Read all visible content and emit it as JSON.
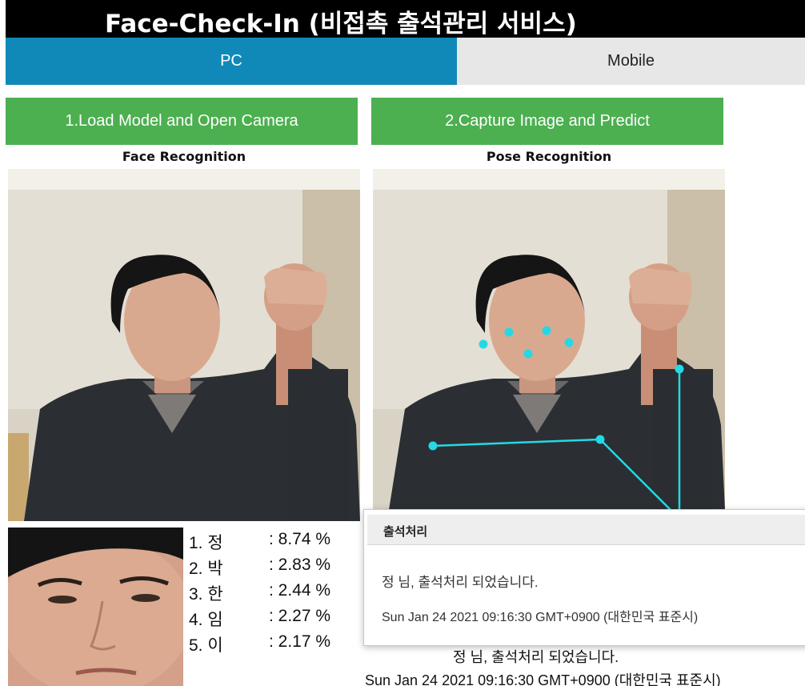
{
  "header": {
    "title": "Face-Check-In (비접촉 출석관리 서비스)"
  },
  "tabs": [
    {
      "label": "PC",
      "active": true
    },
    {
      "label": "Mobile",
      "active": false
    }
  ],
  "buttons": {
    "load_model": "1.Load Model and Open Camera",
    "capture_predict": "2.Capture Image and Predict"
  },
  "panels": {
    "face_caption": "Face Recognition",
    "pose_caption": "Pose Recognition"
  },
  "predictions": [
    {
      "name": "1. 정",
      "score": ": 8.74 %"
    },
    {
      "name": "2. 박",
      "score": ": 2.83 %"
    },
    {
      "name": "3. 한",
      "score": ": 2.44 %"
    },
    {
      "name": "4. 임",
      "score": ": 2.27 %"
    },
    {
      "name": "5. 이",
      "score": ": 2.17 %"
    }
  ],
  "result": {
    "message": "정      님, 출석처리 되었습니다.",
    "timestamp": "Sun Jan 24 2021 09:16:30 GMT+0900 (대한민국 표준시)"
  },
  "dialog": {
    "title": "출석처리",
    "message": "정      님, 출석처리 되었습니다.",
    "timestamp": "Sun Jan 24 2021 09:16:30 GMT+0900 (대한민국 표준시)"
  },
  "colors": {
    "title_bg": "#000000",
    "tab_active": "#1089b8",
    "tab_inactive": "#e7e7e7",
    "button": "#4caf50",
    "keypoint": "#25d8e6"
  }
}
